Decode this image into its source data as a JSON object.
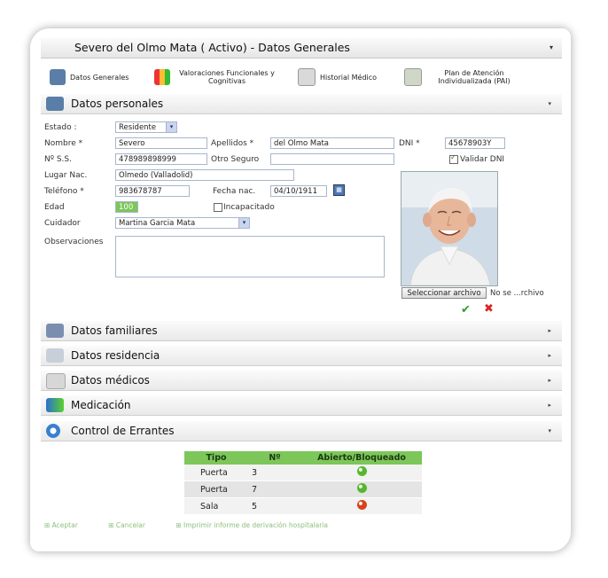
{
  "window": {
    "title": "Severo del Olmo Mata ( Activo) - Datos Generales"
  },
  "tabs": [
    {
      "label": "Datos Generales",
      "icon": "people-icon"
    },
    {
      "label": "Valoraciones Funcionales y Cognitivas",
      "icon": "bar-chart-icon"
    },
    {
      "label": "Historial Médico",
      "icon": "clipboard-icon"
    },
    {
      "label": "Plan de Atención Individualizada (PAI)",
      "icon": "document-person-icon"
    }
  ],
  "sections": {
    "personal": "Datos personales",
    "familiares": "Datos familiares",
    "residencia": "Datos residencia",
    "medicos": "Datos médicos",
    "medicacion": "Medicación",
    "errantes": "Control de Errantes"
  },
  "form": {
    "estado_label": "Estado :",
    "estado_value": "Residente",
    "nombre_label": "Nombre *",
    "nombre_value": "Severo",
    "apellidos_label": "Apellidos *",
    "apellidos_value": "del Olmo Mata",
    "dni_label": "DNI *",
    "dni_value": "45678903Y",
    "nss_label": "Nº S.S.",
    "nss_value": "478989898999",
    "otro_seguro_label": "Otro Seguro",
    "otro_seguro_value": "",
    "validar_dni_label": "Validar DNI",
    "lugar_label": "Lugar Nac.",
    "lugar_value": "Olmedo (Valladolid)",
    "telefono_label": "Teléfono *",
    "telefono_value": "983678787",
    "fecha_label": "Fecha nac.",
    "fecha_value": "04/10/1911",
    "edad_label": "Edad",
    "edad_value": "100",
    "incapacitado_label": "Incapacitado",
    "cuidador_label": "Cuidador",
    "cuidador_value": "Martina Garcia Mata",
    "observaciones_label": "Observaciones",
    "observaciones_value": "",
    "file_button": "Seleccionar archivo",
    "file_status": "No se ...rchivo"
  },
  "errantes_table": {
    "headers": [
      "Tipo",
      "Nº",
      "Abierto/Bloqueado"
    ],
    "rows": [
      {
        "tipo": "Puerta",
        "n": "3",
        "status_color": "#55b82c"
      },
      {
        "tipo": "Puerta",
        "n": "7",
        "status_color": "#55b82c"
      },
      {
        "tipo": "Sala",
        "n": "5",
        "status_color": "#d9431b"
      }
    ]
  },
  "footer": {
    "aceptar": "Aceptar",
    "cancelar": "Cancelar",
    "informe": "Imprimir informe de derivación hospitalaria"
  },
  "colors": {
    "accent_green": "#7cc65a",
    "confirm": "#2e9e2e",
    "cancel": "#d22"
  }
}
